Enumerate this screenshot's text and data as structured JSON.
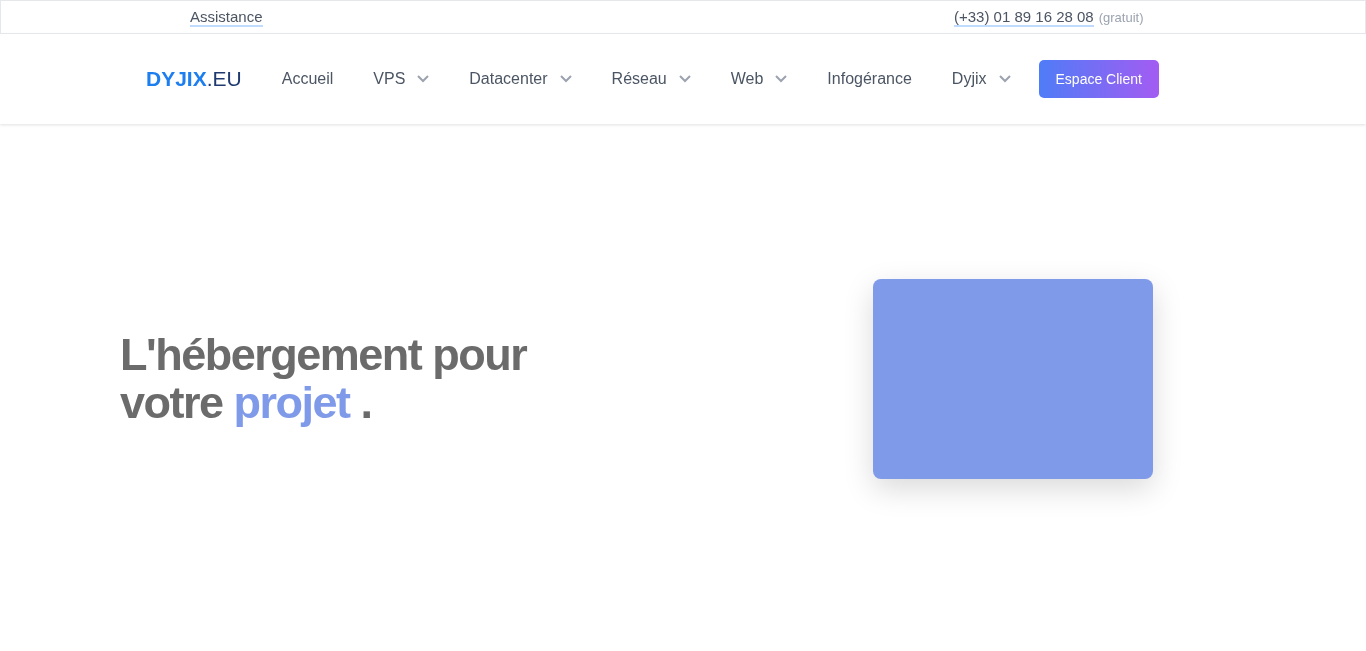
{
  "top_bar": {
    "assistance_link": "Assistance",
    "phone": "(+33) 01 89 16 28 08",
    "phone_note": "(gratuit)"
  },
  "nav": {
    "logo": {
      "main": "DYJIX",
      "suffix": ".EU"
    },
    "items": [
      {
        "label": "Accueil",
        "dropdown": false
      },
      {
        "label": "VPS",
        "dropdown": true
      },
      {
        "label": "Datacenter",
        "dropdown": true
      },
      {
        "label": "Réseau",
        "dropdown": true
      },
      {
        "label": "Web",
        "dropdown": true
      },
      {
        "label": "Infogérance",
        "dropdown": false
      },
      {
        "label": "Dyjix",
        "dropdown": true
      }
    ],
    "cta": "Espace Client"
  },
  "hero": {
    "heading": {
      "line_1": "L'hébergement pour",
      "before": "votre",
      "highlight": "projet",
      "after": "."
    },
    "card": {
      "color": "#7f9ae8"
    }
  }
}
